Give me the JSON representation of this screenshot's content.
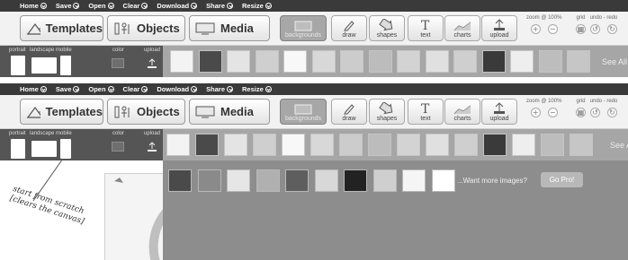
{
  "menu": [
    {
      "label": "Home"
    },
    {
      "label": "Save"
    },
    {
      "label": "Open"
    },
    {
      "label": "Clear"
    },
    {
      "label": "Download"
    },
    {
      "label": "Share"
    },
    {
      "label": "Resize"
    }
  ],
  "toolbar": {
    "templates_label": "Templates",
    "objects_label": "Objects",
    "media_label": "Media",
    "tools": [
      {
        "label": "backgrounds",
        "icon": "background-icon",
        "active": true
      },
      {
        "label": "draw",
        "icon": "pencil-icon",
        "active": false
      },
      {
        "label": "shapes",
        "icon": "arrow-shape-icon",
        "active": false
      },
      {
        "label": "text",
        "icon": "text-icon",
        "active": false
      },
      {
        "label": "charts",
        "icon": "chart-icon",
        "active": false
      },
      {
        "label": "upload",
        "icon": "upload-icon",
        "active": false
      }
    ],
    "zoom_label": "zoom @ 100%",
    "grid_label": "grid",
    "undo_redo_label": "undo - redo"
  },
  "left_tools": {
    "portrait": "portrait",
    "landscape": "landscape",
    "mobile": "mobile",
    "color": "color",
    "upload": "upload"
  },
  "background_thumbs": [
    "#f3f3f3",
    "#4a4a4a",
    "#e4e4e4",
    "#cfcfcf",
    "#f8f8f8",
    "#d8d8d8",
    "#cccccc",
    "#bcbcbc",
    "#d3d3d3",
    "#e0e0e0",
    "#cfcfcf",
    "#3a3a3a",
    "#eeeeee",
    "#bdbdbd",
    "#c6c6c6"
  ],
  "see_all_label": "See All",
  "gallery_thumbs": [
    "#4a4a4a",
    "#8a8a8a",
    "#e6e6e6",
    "#b0b0b0",
    "#5e5e5e",
    "#d8d8d8",
    "#222222",
    "#cfcfcf",
    "#f5f5f5",
    "#ffffff"
  ],
  "more_images_text": "...Want more images?",
  "go_pro_label": "Go Pro!",
  "annotation": {
    "line1": "start from scratch",
    "line2": "[clears the canvas]"
  }
}
